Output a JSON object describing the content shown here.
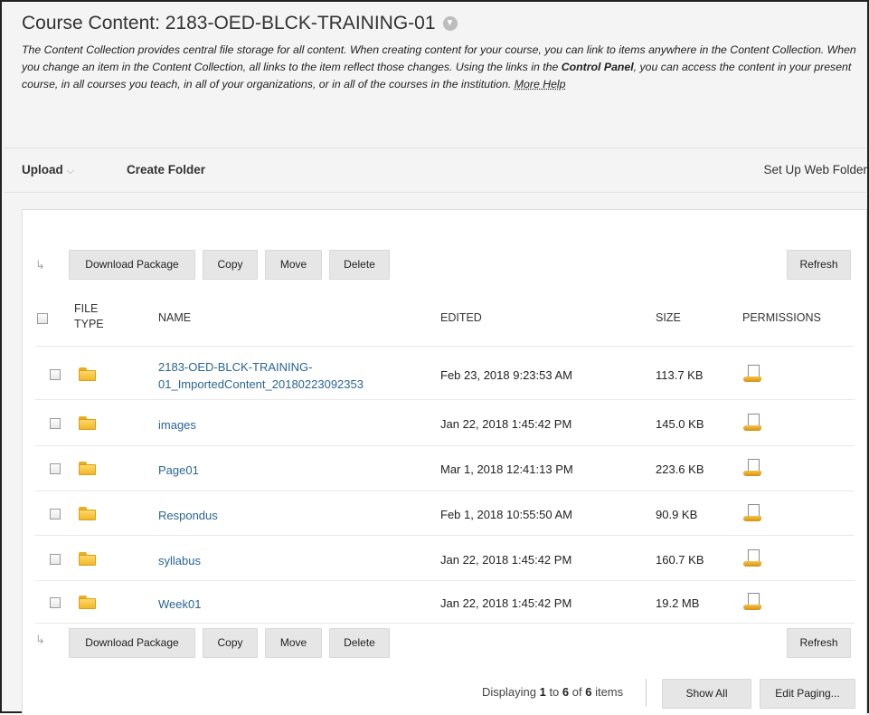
{
  "header": {
    "title": "Course Content: 2183-OED-BLCK-TRAINING-01",
    "title_menu_icon": "chevron-down-icon",
    "description_part1": "The Content Collection provides central file storage for all content. When creating content for your course, you can link to items anywhere in the Content Collection. When you change an item in the Content Collection, all links to the item reflect those changes. Using the links in the ",
    "description_bold": "Control Panel",
    "description_part2": ", you can access the content in your present course, in all courses you teach, in all of your organizations, or in all of the courses in the institution. ",
    "more_help": "More Help"
  },
  "toolbar": {
    "upload": "Upload",
    "upload_caret": "⌵",
    "create_folder": "Create Folder",
    "web_folder": "Set Up Web Folder"
  },
  "actions": {
    "download": "Download Package",
    "copy": "Copy",
    "move": "Move",
    "delete": "Delete",
    "refresh": "Refresh"
  },
  "columns": {
    "file_type_1": "FILE",
    "file_type_2": "TYPE",
    "name": "NAME",
    "edited": "EDITED",
    "size": "SIZE",
    "permissions": "PERMISSIONS"
  },
  "rows": [
    {
      "name_line1": "2183-OED-BLCK-TRAINING-",
      "name_line2": "01_ImportedContent_20180223092353",
      "edited": "Feb 23, 2018 9:23:53 AM",
      "size": "113.7 KB"
    },
    {
      "name_line1": "images",
      "name_line2": "",
      "edited": "Jan 22, 2018 1:45:42 PM",
      "size": "145.0 KB"
    },
    {
      "name_line1": "Page01",
      "name_line2": "",
      "edited": "Mar 1, 2018 12:41:13 PM",
      "size": "223.6 KB"
    },
    {
      "name_line1": "Respondus",
      "name_line2": "",
      "edited": "Feb 1, 2018 10:55:50 AM",
      "size": "90.9 KB"
    },
    {
      "name_line1": "syllabus",
      "name_line2": "",
      "edited": "Jan 22, 2018 1:45:42 PM",
      "size": "160.7 KB"
    },
    {
      "name_line1": "Week01",
      "name_line2": "",
      "edited": "Jan 22, 2018 1:45:42 PM",
      "size": "19.2 MB"
    }
  ],
  "paging": {
    "displaying": "Displaying ",
    "from": "1",
    "to_word": " to ",
    "to": "6",
    "of_word": " of ",
    "total": "6",
    "items_word": " items",
    "show_all": "Show All",
    "edit_paging": "Edit Paging..."
  },
  "icons": {
    "folder": "folder-icon",
    "permissions": "permissions-icon",
    "arrow_top": "↳",
    "arrow_bottom": "↳"
  }
}
